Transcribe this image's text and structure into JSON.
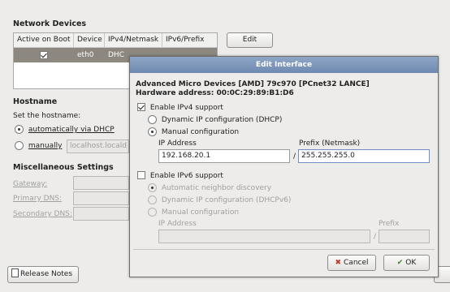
{
  "network_devices": {
    "title": "Network Devices",
    "columns": [
      "Active on Boot",
      "Device",
      "IPv4/Netmask",
      "IPv6/Prefix"
    ],
    "row": {
      "active": true,
      "device": "eth0",
      "ipv4": "DHC",
      "ipv6": ""
    },
    "edit_button": "Edit"
  },
  "hostname": {
    "title": "Hostname",
    "set_label": "Set the hostname:",
    "auto_option": "automatically via DHCP",
    "manual_option": "manually",
    "hostname_value": "localhost.locald"
  },
  "misc": {
    "title": "Miscellaneous Settings",
    "gateway": "Gateway:",
    "primary_dns": "Primary DNS:",
    "secondary_dns": "Secondary DNS:"
  },
  "release_notes": "Release Notes",
  "dialog": {
    "title": "Edit Interface",
    "device_name": "Advanced Micro Devices [AMD] 79c970 [PCnet32 LANCE]",
    "hw_address": "Hardware address: 00:0C:29:89:B1:D6",
    "ipv4": {
      "enable_label": "Enable IPv4 support",
      "enabled": true,
      "dhcp_option": "Dynamic IP configuration (DHCP)",
      "manual_option": "Manual configuration",
      "ip_label": "IP Address",
      "prefix_label": "Prefix (Netmask)",
      "ip_value": "192.168.20.1",
      "separator": "/",
      "prefix_value": "255.255.255.0"
    },
    "ipv6": {
      "enable_label": "Enable IPv6 support",
      "enabled": false,
      "auto_option": "Automatic neighbor discovery",
      "dhcp_option": "Dynamic IP configuration (DHCPv6)",
      "manual_option": "Manual configuration",
      "ip_label": "IP Address",
      "prefix_label": "Prefix",
      "separator": "/"
    },
    "cancel_button": "Cancel",
    "ok_button": "OK"
  }
}
